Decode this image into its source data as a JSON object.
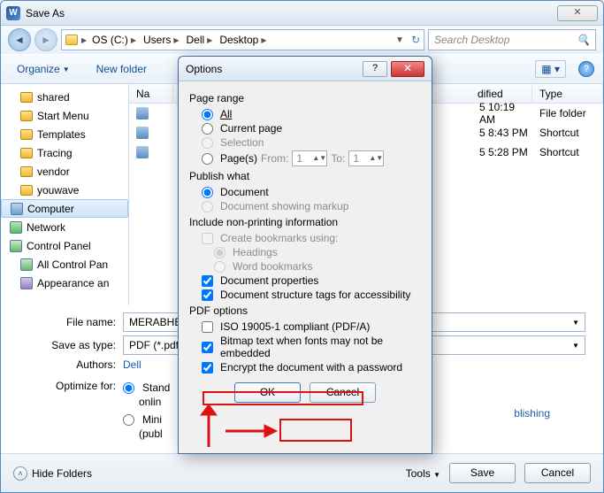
{
  "window": {
    "title": "Save As"
  },
  "nav": {
    "crumbs": [
      "OS (C:)",
      "Users",
      "Dell",
      "Desktop"
    ],
    "search_placeholder": "Search Desktop"
  },
  "toolbar": {
    "organize": "Organize",
    "newfolder": "New folder"
  },
  "tree": [
    {
      "label": "shared",
      "icon": "folder"
    },
    {
      "label": "Start Menu",
      "icon": "folder"
    },
    {
      "label": "Templates",
      "icon": "folder"
    },
    {
      "label": "Tracing",
      "icon": "folder"
    },
    {
      "label": "vendor",
      "icon": "folder"
    },
    {
      "label": "youwave",
      "icon": "folder"
    },
    {
      "label": "Computer",
      "icon": "computer",
      "selected": true
    },
    {
      "label": "Network",
      "icon": "network"
    },
    {
      "label": "Control Panel",
      "icon": "control"
    },
    {
      "label": "All Control Pan",
      "icon": "control"
    },
    {
      "label": "Appearance an",
      "icon": "appearance"
    }
  ],
  "cols": {
    "name": "Na",
    "modified": "dified",
    "type": "Type"
  },
  "rows": [
    {
      "modified": "5 10:19 AM",
      "type": "File folder"
    },
    {
      "modified": "5 8:43 PM",
      "type": "Shortcut"
    },
    {
      "modified": "5 5:28 PM",
      "type": "Shortcut"
    }
  ],
  "filename_label": "File name:",
  "filename_value": "MERABHEJ",
  "saveas_label": "Save as type:",
  "saveas_value": "PDF (*.pdf)",
  "authors_label": "Authors:",
  "authors_value": "Dell",
  "optimize_label": "Optimize for:",
  "optimize_std": "Stand",
  "optimize_std2": "onlin",
  "optimize_min": "Mini",
  "optimize_min2": "(publ",
  "publishing_tail": "blishing",
  "hide": "Hide Folders",
  "tools": "Tools",
  "save": "Save",
  "cancel": "Cancel",
  "options": {
    "title": "Options",
    "page_range": "Page range",
    "all": "All",
    "current": "Current page",
    "selection": "Selection",
    "pages": "Page(s)",
    "from": "From:",
    "from_val": "1",
    "to": "To:",
    "to_val": "1",
    "publish": "Publish what",
    "document": "Document",
    "markup": "Document showing markup",
    "nonprint": "Include non-printing information",
    "create_bm": "Create bookmarks using:",
    "headings": "Headings",
    "word_bm": "Word bookmarks",
    "docprops": "Document properties",
    "struct": "Document structure tags for accessibility",
    "pdfopt": "PDF options",
    "iso": "ISO 19005-1 compliant (PDF/A)",
    "bitmap": "Bitmap text when fonts may not be embedded",
    "encrypt": "Encrypt the document with a password",
    "ok": "OK",
    "cancel": "Cancel"
  }
}
